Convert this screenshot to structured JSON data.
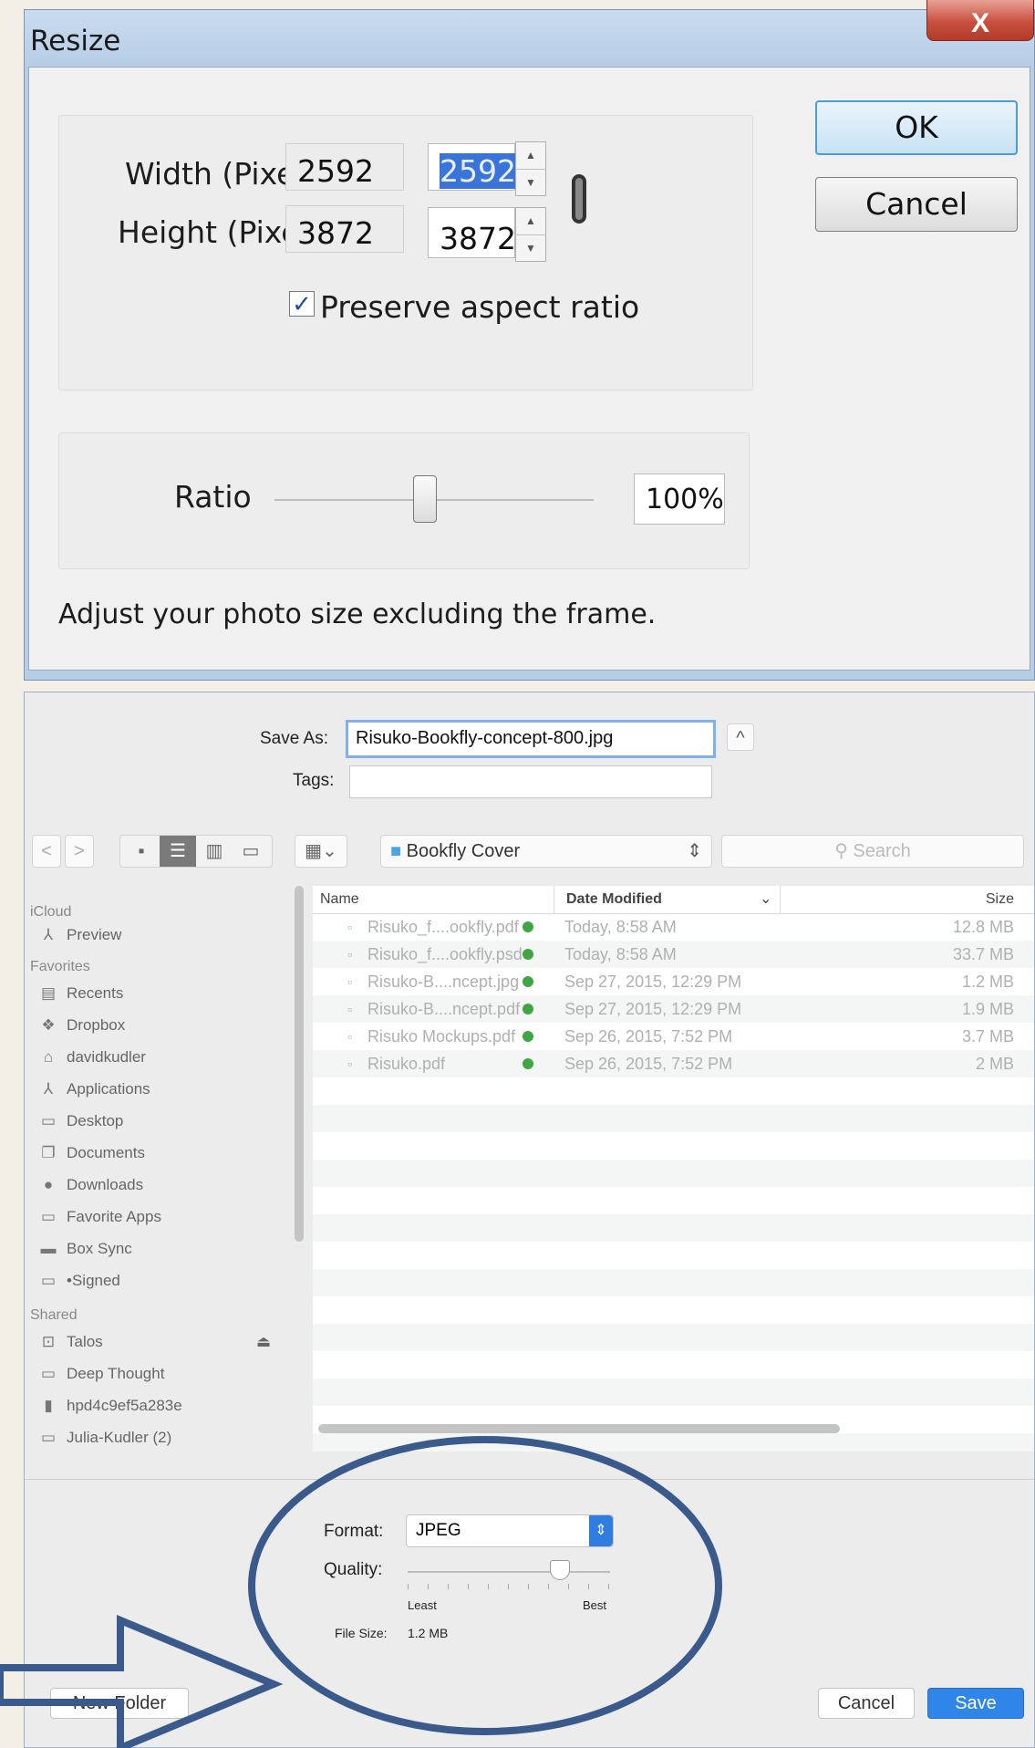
{
  "resize_dialog": {
    "title": "Resize",
    "close_glyph": "X",
    "width_label": "Width (Pixel)",
    "height_label": "Height (Pixel)",
    "width_original": "2592",
    "height_original": "3872",
    "width_value": "2592",
    "height_value": "3872",
    "preserve_label": "Preserve aspect ratio",
    "preserve_checked": true,
    "check_glyph": "✓",
    "ratio_label": "Ratio",
    "ratio_value": "100%",
    "ratio_slider_level": 0.47,
    "hint": "Adjust your photo size excluding the frame.",
    "ok_label": "OK",
    "cancel_label": "Cancel",
    "spin_up": "▲",
    "spin_down": "▼"
  },
  "save_dialog": {
    "save_as_label": "Save As:",
    "save_as_value": "Risuko-Bookfly-concept-800.jpg",
    "tags_label": "Tags:",
    "tags_value": "",
    "expand_glyph": "^",
    "toolbar": {
      "back": "<",
      "forward": ">",
      "location": "Bookfly Cover",
      "location_chevron": "⇕",
      "search_placeholder": "Search",
      "search_glyph": "⚲"
    },
    "sidebar": {
      "icloud_header": "iCloud",
      "icloud_items": [
        {
          "label": "Preview",
          "icon": "app-icon"
        }
      ],
      "favorites_header": "Favorites",
      "favorites": [
        {
          "label": "Recents",
          "icon": "recents-icon"
        },
        {
          "label": "Dropbox",
          "icon": "dropbox-icon"
        },
        {
          "label": "davidkudler",
          "icon": "home-icon"
        },
        {
          "label": "Applications",
          "icon": "applications-icon"
        },
        {
          "label": "Desktop",
          "icon": "desktop-icon"
        },
        {
          "label": "Documents",
          "icon": "documents-icon"
        },
        {
          "label": "Downloads",
          "icon": "downloads-icon"
        },
        {
          "label": "Favorite Apps",
          "icon": "folder-icon"
        },
        {
          "label": "Box Sync",
          "icon": "box-icon"
        },
        {
          "label": "•Signed",
          "icon": "folder-icon"
        }
      ],
      "shared_header": "Shared",
      "shared": [
        {
          "label": "Talos",
          "icon": "server-icon"
        },
        {
          "label": "Deep Thought",
          "icon": "display-icon"
        },
        {
          "label": "hpd4c9ef5a283e",
          "icon": "computer-icon"
        },
        {
          "label": "Julia-Kudler (2)",
          "icon": "computer-icon"
        }
      ],
      "eject_glyph": "⏏"
    },
    "columns": {
      "name": "Name",
      "date": "Date Modified",
      "size": "Size",
      "sort_glyph": "⌄"
    },
    "files": [
      {
        "name": "Risuko_f....ookfly.pdf",
        "date": "Today, 8:58 AM",
        "size": "12.8 MB"
      },
      {
        "name": "Risuko_f....ookfly.psd",
        "date": "Today, 8:58 AM",
        "size": "33.7 MB"
      },
      {
        "name": "Risuko-B....ncept.jpg",
        "date": "Sep 27, 2015, 12:29 PM",
        "size": "1.2 MB"
      },
      {
        "name": "Risuko-B....ncept.pdf",
        "date": "Sep 27, 2015, 12:29 PM",
        "size": "1.9 MB"
      },
      {
        "name": "Risuko Mockups.pdf",
        "date": "Sep 26, 2015, 7:52 PM",
        "size": "3.7 MB"
      },
      {
        "name": "Risuko.pdf",
        "date": "Sep 26, 2015, 7:52 PM",
        "size": "2 MB"
      }
    ],
    "format_label": "Format:",
    "format_value": "JPEG",
    "quality_label": "Quality:",
    "quality_level": 0.75,
    "least_label": "Least",
    "best_label": "Best",
    "file_size_label": "File Size:",
    "file_size_value": "1.2 MB",
    "new_folder_label": "New Folder",
    "cancel_label": "Cancel",
    "save_label": "Save"
  },
  "colors": {
    "annotation": "#3a5a8c",
    "accent": "#2f7de1",
    "sync_green": "#3fa643"
  }
}
